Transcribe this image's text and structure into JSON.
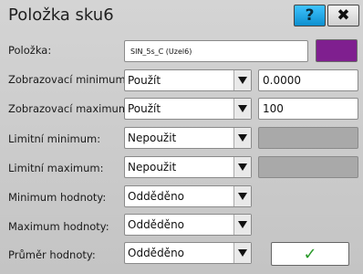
{
  "dialog": {
    "title": "Položka sku6",
    "help_label": "?",
    "close_label": "✖"
  },
  "colors": {
    "swatch": "#7f1f8f",
    "help_button": "#1aa7e8",
    "ok_check": "#2a9a2a"
  },
  "rows": {
    "item": {
      "label": "Položka:",
      "value": "SIN_5s_C (Uzel6)"
    },
    "disp_min": {
      "label": "Zobrazovací minimum:",
      "mode": "Použít",
      "value": "0.0000"
    },
    "disp_max": {
      "label": "Zobrazovací maximum:",
      "mode": "Použít",
      "value": "100"
    },
    "limit_min": {
      "label": "Limitní minimum:",
      "mode": "Nepoužit"
    },
    "limit_max": {
      "label": "Limitní maximum:",
      "mode": "Nepoužit"
    },
    "val_min": {
      "label": "Minimum hodnoty:",
      "mode": "Odděděno"
    },
    "val_max": {
      "label": "Maximum hodnoty:",
      "mode": "Odděděno"
    },
    "val_avg": {
      "label": "Průměr hodnoty:",
      "mode": "Odděděno"
    }
  },
  "ok_label": "✓"
}
